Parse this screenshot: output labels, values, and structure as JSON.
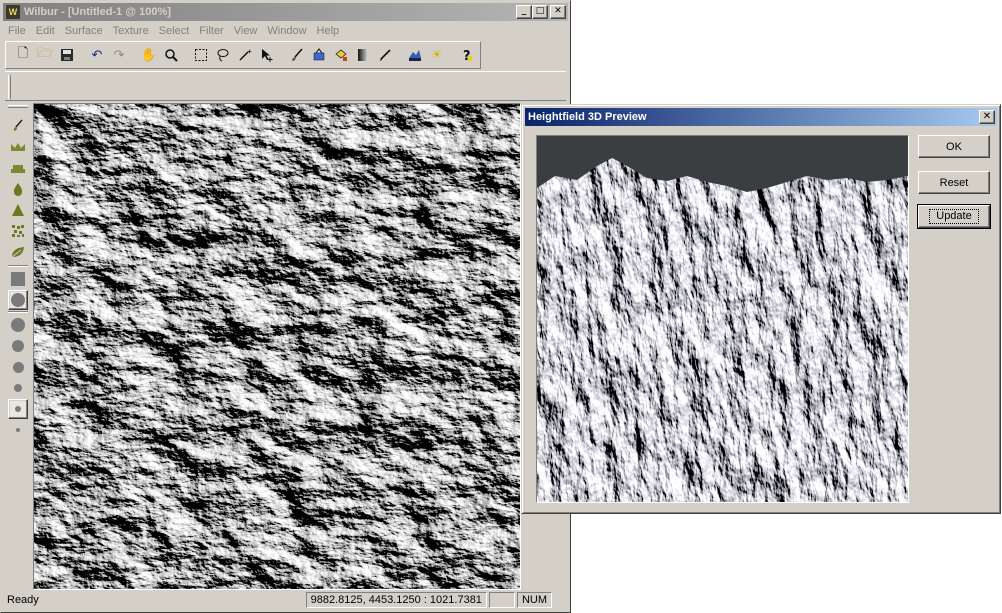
{
  "main_window": {
    "title": "Wilbur - [Untitled-1 @ 100%]",
    "app_icon": "W",
    "title_buttons": {
      "minimize": "_",
      "maximize": "□",
      "close": "✕"
    },
    "menu": [
      "File",
      "Edit",
      "Surface",
      "Texture",
      "Select",
      "Filter",
      "View",
      "Window",
      "Help"
    ],
    "toolbar_icons": [
      "new-icon",
      "open-icon",
      "save-icon",
      "undo-icon",
      "redo-icon",
      "hand-icon",
      "zoom-icon",
      "rect-select-icon",
      "lasso-icon",
      "magic-wand-icon",
      "move-icon",
      "brush-icon",
      "fill-icon",
      "texture-fill-icon",
      "gradient-icon",
      "pencil-icon",
      "preview-3d-icon",
      "light-icon",
      "help-icon"
    ],
    "left_tool_icons": [
      "brush-tool-icon",
      "raise-tool-icon",
      "terrace-tool-icon",
      "drop-tool-icon",
      "peak-tool-icon",
      "noise-tool-icon",
      "leaf-tool-icon"
    ],
    "status": {
      "text": "Ready",
      "coordinates": "9882.8125, 4453.1250 : 1021.7381",
      "num": "NUM"
    }
  },
  "preview_dialog": {
    "title": "Heightfield 3D Preview",
    "close": "✕",
    "buttons": {
      "ok": "OK",
      "reset": "Reset",
      "update": "Update"
    }
  },
  "colors": {
    "window_face": "#d4d0c8",
    "active_title_start": "#0a246a",
    "active_title_end": "#a6caf0",
    "inactive_title": "#808080",
    "sky": "#3a3e40"
  }
}
